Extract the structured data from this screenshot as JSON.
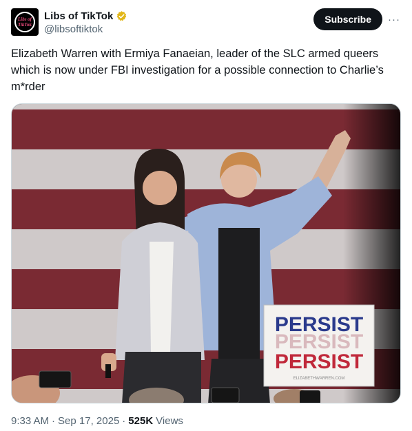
{
  "author": {
    "display_name": "Libs of TikTok",
    "handle": "@libsoftiktok",
    "avatar_text": "Libs of TikTok",
    "verified": true
  },
  "actions": {
    "subscribe_label": "Subscribe",
    "more_label": "···"
  },
  "tweet": {
    "text": "Elizabeth Warren with Ermiya Fanaeian, leader of the SLC armed queers which is now under FBI investigation for a possible connection to Charlie’s m*rder"
  },
  "media": {
    "sign_lines": [
      "PERSIST",
      "PERSIST",
      "PERSIST"
    ],
    "sign_footer": "ELIZABETHWARREN.COM",
    "colors": {
      "stripe_red": "#7a2a33",
      "stripe_white": "#cfc9c9",
      "sign_blue": "#2a3a8c",
      "sign_red": "#c0283a"
    }
  },
  "meta": {
    "time": "9:33 AM",
    "date": "Sep 17, 2025",
    "views_count": "525K",
    "views_label": "Views",
    "separator": "·"
  }
}
